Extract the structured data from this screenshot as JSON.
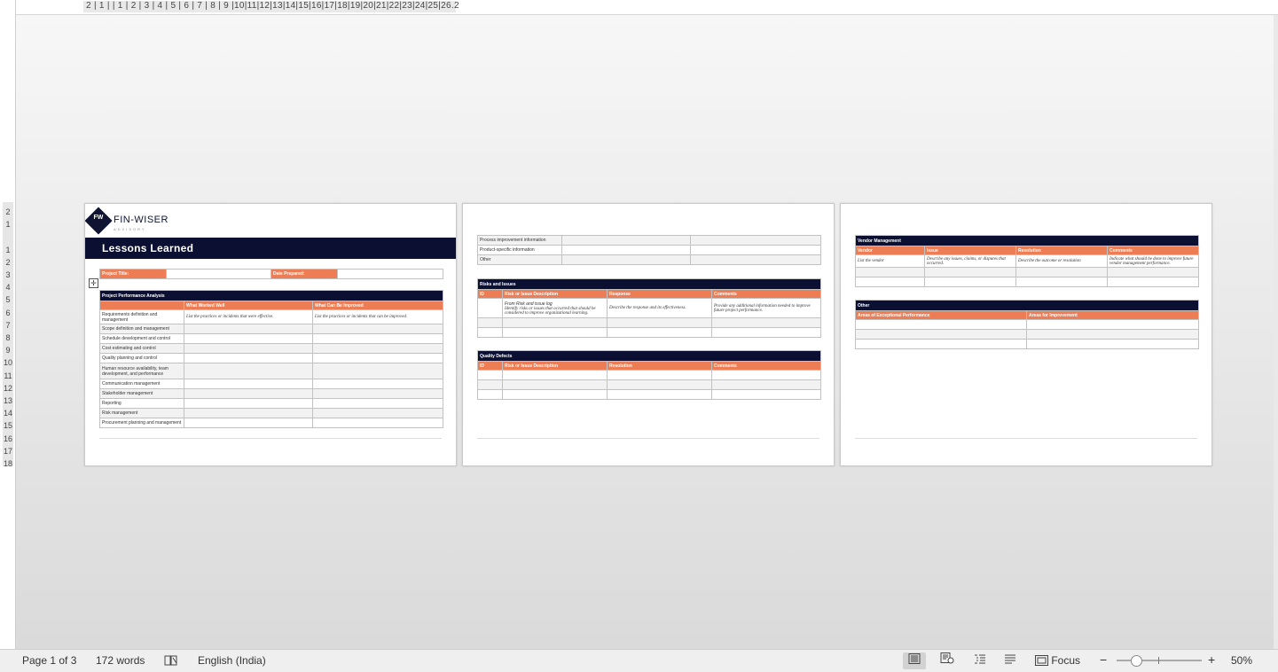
{
  "ruler": {
    "corner_icon": "indent-marker-icon",
    "h_numbers": "2 | 1 |   | 1 | 2 | 3 | 4 | 5 | 6 | 7 | 8 | 9 |10|11|12|13|14|15|16|17|18|19|20|21|22|23|24|25|26.2",
    "v_numbers": [
      "2",
      "1",
      "",
      "1",
      "2",
      "3",
      "4",
      "5",
      "6",
      "7",
      "8",
      "9",
      "10",
      "11",
      "12",
      "13",
      "14",
      "15",
      "16",
      "17",
      "18"
    ]
  },
  "page1": {
    "logo_mark": "FW",
    "logo_name": "FIN-WISER",
    "logo_sub": "ADVISORY",
    "title": "Lessons Learned",
    "move_icon": "✛",
    "info": {
      "project_title_label": "Project Title:",
      "date_label": "Date Prepared:"
    },
    "perf": {
      "header": "Project Performance Analysis",
      "col1": "What Worked Well",
      "col2": "What Can Be Improved",
      "hint1": "List the practices or incidents that were effective.",
      "hint2": "List the practices or incidents that can be improved.",
      "rows": [
        "Requirements definition and management",
        "Scope definition and management",
        "Schedule development and control",
        "Cost estimating and control",
        "Quality planning and control",
        "Human resource availability, team development, and performance",
        "Communication management",
        "Stakeholder management",
        "Reporting",
        "Risk management",
        "Procurement planning and management"
      ]
    }
  },
  "page2": {
    "continued_rows": [
      "Process improvement information",
      "Product-specific information",
      "Other"
    ],
    "risks": {
      "header": "Risks and Issues",
      "cols": [
        "ID",
        "Risk or Issue Description",
        "Response",
        "Comments"
      ],
      "desc_line1": "From Risk and issue log",
      "desc_line2": "Identify risks or issues that occurred that should be considered to improve organizational learning.",
      "response_hint": "Describe the response and its effectiveness.",
      "comments_hint": "Provide any additional information needed to improve future project performance."
    },
    "quality": {
      "header": "Quality Defects",
      "cols": [
        "ID",
        "Risk or Issue Description",
        "Resolution",
        "Comments"
      ]
    }
  },
  "page3": {
    "vendor": {
      "header": "Vendor Management",
      "cols": [
        "Vendor",
        "Issue",
        "Resolution",
        "Comments"
      ],
      "hints": [
        "List the vendor",
        "Describe any issues, claims, or disputes that occurred.",
        "Describe the outcome or resolution",
        "Indicate what should be done to improve future vendor management performance."
      ]
    },
    "other": {
      "header": "Other",
      "cols": [
        "Areas of Exceptional Performance",
        "Areas for Improvement"
      ]
    }
  },
  "status": {
    "page": "Page 1 of 3",
    "words": "172 words",
    "proofing_icon": "proofing-icon",
    "language": "English (India)",
    "focus": "Focus",
    "zoom_minus": "−",
    "zoom_plus": "+",
    "zoom": "50%"
  },
  "colors": {
    "navy": "#0b1033",
    "orange": "#ec7d54"
  }
}
